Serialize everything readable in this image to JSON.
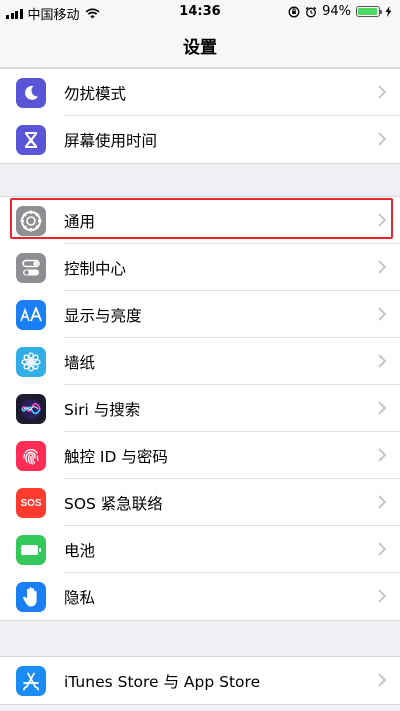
{
  "status_bar": {
    "carrier": "中国移动",
    "time": "14:36",
    "battery": "94%",
    "battery_level": 0.94
  },
  "nav": {
    "title": "设置"
  },
  "groups": [
    {
      "items": [
        {
          "label": "勿扰模式",
          "icon": "moon-icon",
          "color": "#5856d6"
        },
        {
          "label": "屏幕使用时间",
          "icon": "hourglass-icon",
          "color": "#5856d6"
        }
      ]
    },
    {
      "items": [
        {
          "label": "通用",
          "icon": "gear-icon",
          "color": "#8e8e93",
          "highlighted": true
        },
        {
          "label": "控制中心",
          "icon": "toggle-switches-icon",
          "color": "#8e8e93"
        },
        {
          "label": "显示与亮度",
          "icon": "text-size-icon",
          "color": "#1a7ff4"
        },
        {
          "label": "墙纸",
          "icon": "flower-icon",
          "color": "#32ade6"
        },
        {
          "label": "Siri 与搜索",
          "icon": "siri-icon",
          "color": "#1c1c2e"
        },
        {
          "label": "触控 ID 与密码",
          "icon": "fingerprint-icon",
          "color": "#ff2d55"
        },
        {
          "label": "SOS 紧急联络",
          "icon": "sos-icon",
          "color": "#ff3b30",
          "icon_text": "SOS"
        },
        {
          "label": "电池",
          "icon": "battery-icon",
          "color": "#34c759"
        },
        {
          "label": "隐私",
          "icon": "hand-icon",
          "color": "#1a7ff4"
        }
      ]
    },
    {
      "items": [
        {
          "label": "iTunes Store 与 App Store",
          "icon": "app-store-icon",
          "color": "#1a8cf4"
        }
      ]
    }
  ]
}
